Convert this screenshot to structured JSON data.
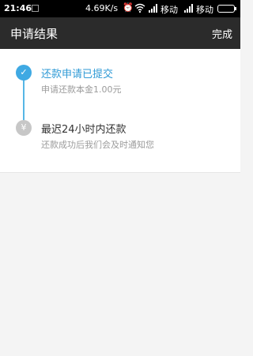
{
  "status_bar": {
    "time": "21:46",
    "speed": "4.69K/s",
    "carrier1": "移动",
    "carrier2": "移动",
    "icons": [
      "notification-icon",
      "alarm-icon",
      "wifi-icon",
      "signal-icon",
      "signal-icon",
      "battery-icon"
    ]
  },
  "title_bar": {
    "title": "申请结果",
    "done_label": "完成"
  },
  "steps": [
    {
      "title": "还款申请已提交",
      "subtitle": "申请还款本金1.00元",
      "status": "done",
      "icon": "check-icon",
      "symbol": "✓"
    },
    {
      "title": "最迟24小时内还款",
      "subtitle": "还款成功后我们会及时通知您",
      "status": "pending",
      "icon": "yen-icon",
      "symbol": "¥"
    }
  ],
  "colors": {
    "accent": "#3fa9e3",
    "header_bg": "#2b2b2b",
    "pending": "#c7c7c7",
    "background": "#f4f4f4"
  }
}
